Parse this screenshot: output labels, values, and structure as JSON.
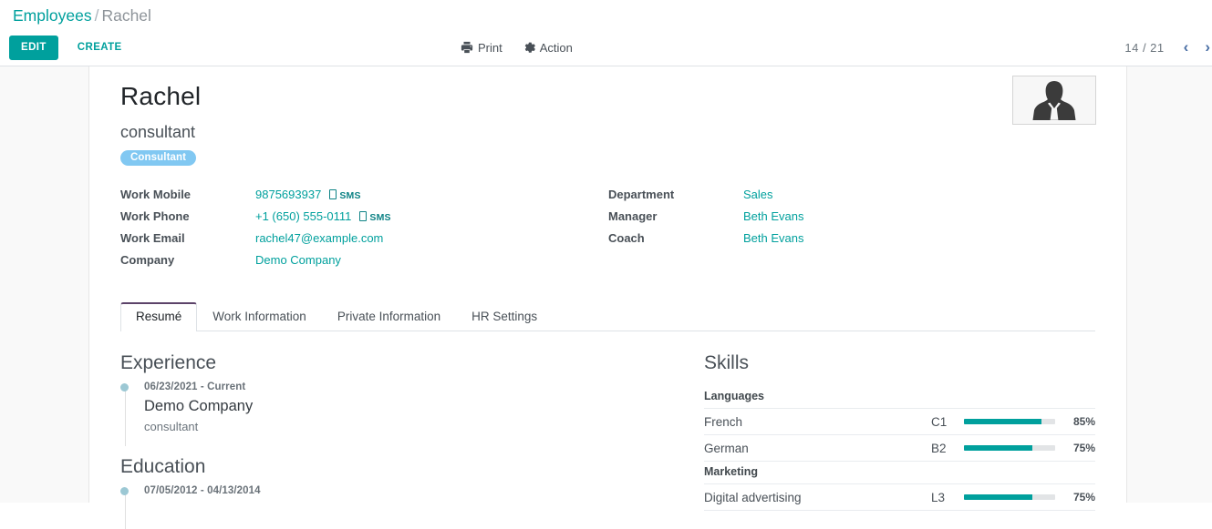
{
  "breadcrumb": {
    "root": "Employees",
    "separator": "/",
    "current": "Rachel"
  },
  "control_panel": {
    "edit_label": "EDIT",
    "create_label": "CREATE",
    "print_label": "Print",
    "action_label": "Action",
    "pager": {
      "count": "14 / 21",
      "prev": "‹",
      "next": "›"
    }
  },
  "record": {
    "name": "Rachel",
    "job_title": "consultant",
    "tag": "Consultant",
    "avatar_alt": "employee-avatar"
  },
  "fields_left": [
    {
      "label": "Work Mobile",
      "value": "9875693937",
      "sms": "SMS"
    },
    {
      "label": "Work Phone",
      "value": "+1 (650) 555-0111",
      "sms": "SMS"
    },
    {
      "label": "Work Email",
      "value": "rachel47@example.com",
      "sms": ""
    },
    {
      "label": "Company",
      "value": "Demo Company",
      "sms": ""
    }
  ],
  "fields_right": [
    {
      "label": "Department",
      "value": "Sales"
    },
    {
      "label": "Manager",
      "value": "Beth Evans"
    },
    {
      "label": "Coach",
      "value": "Beth Evans"
    }
  ],
  "tabs": [
    {
      "label": "Resumé",
      "active": true
    },
    {
      "label": "Work Information",
      "active": false
    },
    {
      "label": "Private Information",
      "active": false
    },
    {
      "label": "HR Settings",
      "active": false
    }
  ],
  "resume": {
    "experience": {
      "heading": "Experience",
      "items": [
        {
          "date": "06/23/2021 - Current",
          "title": "Demo Company",
          "description": "consultant"
        }
      ]
    },
    "education": {
      "heading": "Education",
      "items": [
        {
          "date": "07/05/2012 - 04/13/2014",
          "title": "",
          "description": ""
        }
      ]
    }
  },
  "skills": {
    "heading": "Skills",
    "groups": [
      {
        "name": "Languages",
        "rows": [
          {
            "name": "French",
            "level": "C1",
            "percent": "85%",
            "value": 85
          },
          {
            "name": "German",
            "level": "B2",
            "percent": "75%",
            "value": 75
          }
        ]
      },
      {
        "name": "Marketing",
        "rows": [
          {
            "name": "Digital advertising",
            "level": "L3",
            "percent": "75%",
            "value": 75
          }
        ]
      }
    ]
  },
  "colors": {
    "accent": "#00A09D",
    "tag": "#81c8f2",
    "tab_active_border": "#5c4369",
    "timeline_dot": "#9cc8d4",
    "bar_track": "#e2e4e6"
  }
}
